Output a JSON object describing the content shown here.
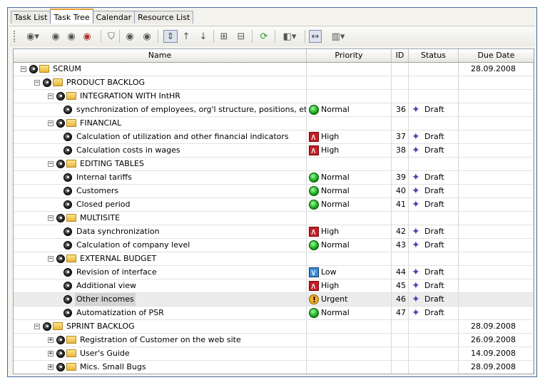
{
  "tabs": [
    {
      "label": "Task List",
      "active": false
    },
    {
      "label": "Task Tree",
      "active": true
    },
    {
      "label": "Calendar",
      "active": false
    },
    {
      "label": "Resource List",
      "active": false
    }
  ],
  "columns": {
    "name": "Name",
    "priority": "Priority",
    "id": "ID",
    "status": "Status",
    "due": "Due Date"
  },
  "rows": [
    {
      "level": 0,
      "kind": "group",
      "expander": "−",
      "name": "SCRUM",
      "priority": "",
      "priority_icon": "",
      "id": "",
      "status": "",
      "due": "28.09.2008"
    },
    {
      "level": 1,
      "kind": "group",
      "expander": "−",
      "name": "PRODUCT BACKLOG",
      "priority": "",
      "priority_icon": "",
      "id": "",
      "status": "",
      "due": ""
    },
    {
      "level": 2,
      "kind": "group",
      "expander": "−",
      "name": "INTEGRATION WITH IntHR",
      "priority": "",
      "priority_icon": "",
      "id": "",
      "status": "",
      "due": ""
    },
    {
      "level": 3,
      "kind": "task",
      "expander": "",
      "name": "synchronization of employees, org'l structure, positions, etc.",
      "priority": "Normal",
      "priority_icon": "normal",
      "id": "36",
      "status": "Draft",
      "due": ""
    },
    {
      "level": 2,
      "kind": "group",
      "expander": "−",
      "name": "FINANCIAL",
      "priority": "",
      "priority_icon": "",
      "id": "",
      "status": "",
      "due": ""
    },
    {
      "level": 3,
      "kind": "task",
      "expander": "",
      "name": "Calculation of utilization and other financial indicators",
      "priority": "High",
      "priority_icon": "high",
      "id": "37",
      "status": "Draft",
      "due": ""
    },
    {
      "level": 3,
      "kind": "task",
      "expander": "",
      "name": "Calculation costs in wages",
      "priority": "High",
      "priority_icon": "high",
      "id": "38",
      "status": "Draft",
      "due": ""
    },
    {
      "level": 2,
      "kind": "group",
      "expander": "−",
      "name": "EDITING TABLES",
      "priority": "",
      "priority_icon": "",
      "id": "",
      "status": "",
      "due": ""
    },
    {
      "level": 3,
      "kind": "task",
      "expander": "",
      "name": "Internal tariffs",
      "priority": "Normal",
      "priority_icon": "normal",
      "id": "39",
      "status": "Draft",
      "due": ""
    },
    {
      "level": 3,
      "kind": "task",
      "expander": "",
      "name": "Customers",
      "priority": "Normal",
      "priority_icon": "normal",
      "id": "40",
      "status": "Draft",
      "due": ""
    },
    {
      "level": 3,
      "kind": "task",
      "expander": "",
      "name": "Closed period",
      "priority": "Normal",
      "priority_icon": "normal",
      "id": "41",
      "status": "Draft",
      "due": ""
    },
    {
      "level": 2,
      "kind": "group",
      "expander": "−",
      "name": "MULTISITE",
      "priority": "",
      "priority_icon": "",
      "id": "",
      "status": "",
      "due": ""
    },
    {
      "level": 3,
      "kind": "task",
      "expander": "",
      "name": "Data synchronization",
      "priority": "High",
      "priority_icon": "high",
      "id": "42",
      "status": "Draft",
      "due": ""
    },
    {
      "level": 3,
      "kind": "task",
      "expander": "",
      "name": "Calculation of company level",
      "priority": "Normal",
      "priority_icon": "normal",
      "id": "43",
      "status": "Draft",
      "due": ""
    },
    {
      "level": 2,
      "kind": "group",
      "expander": "−",
      "name": "EXTERNAL BUDGET",
      "priority": "",
      "priority_icon": "",
      "id": "",
      "status": "",
      "due": ""
    },
    {
      "level": 3,
      "kind": "task",
      "expander": "",
      "name": "Revision of interface",
      "priority": "Low",
      "priority_icon": "low",
      "id": "44",
      "status": "Draft",
      "due": ""
    },
    {
      "level": 3,
      "kind": "task",
      "expander": "",
      "name": "Additional view",
      "priority": "High",
      "priority_icon": "high",
      "id": "45",
      "status": "Draft",
      "due": ""
    },
    {
      "level": 3,
      "kind": "task",
      "expander": "",
      "name": "Other incomes",
      "priority": "Urgent",
      "priority_icon": "urgent",
      "id": "46",
      "status": "Draft",
      "due": "",
      "selected": true
    },
    {
      "level": 3,
      "kind": "task",
      "expander": "",
      "name": "Automatization of PSR",
      "priority": "Normal",
      "priority_icon": "normal",
      "id": "47",
      "status": "Draft",
      "due": ""
    },
    {
      "level": 1,
      "kind": "group",
      "expander": "−",
      "name": "SPRINT BACKLOG",
      "priority": "",
      "priority_icon": "",
      "id": "",
      "status": "",
      "due": "28.09.2008"
    },
    {
      "level": 2,
      "kind": "group",
      "expander": "+",
      "name": "Registration of Customer on the web site",
      "priority": "",
      "priority_icon": "",
      "id": "",
      "status": "",
      "due": "26.09.2008"
    },
    {
      "level": 2,
      "kind": "group",
      "expander": "+",
      "name": "User's Guide",
      "priority": "",
      "priority_icon": "",
      "id": "",
      "status": "",
      "due": "14.09.2008"
    },
    {
      "level": 2,
      "kind": "group",
      "expander": "+",
      "name": "Mics. Small Bugs",
      "priority": "",
      "priority_icon": "",
      "id": "",
      "status": "",
      "due": "28.09.2008"
    }
  ],
  "toolbar": [
    {
      "name": "add-task-button",
      "glyph": "◉▾"
    },
    {
      "name": "add-subtask-button",
      "glyph": "◉"
    },
    {
      "name": "edit-task-button",
      "glyph": "◉"
    },
    {
      "name": "delete-task-button",
      "glyph": "◉"
    },
    {
      "name": "filter-button",
      "glyph": "⛉"
    },
    {
      "name": "indent-button",
      "glyph": "◉"
    },
    {
      "name": "outdent-button",
      "glyph": "◉"
    },
    {
      "name": "move-updown-button",
      "glyph": "⇕"
    },
    {
      "name": "move-up-button",
      "glyph": "↑"
    },
    {
      "name": "move-down-button",
      "glyph": "↓"
    },
    {
      "name": "expand-all-button",
      "glyph": "⊞"
    },
    {
      "name": "collapse-all-button",
      "glyph": "⊟"
    },
    {
      "name": "refresh-button",
      "glyph": "⟳"
    },
    {
      "name": "view-options-button",
      "glyph": "◧▾"
    },
    {
      "name": "fit-columns-button",
      "glyph": "↔"
    },
    {
      "name": "columns-button",
      "glyph": "▥▾"
    }
  ]
}
